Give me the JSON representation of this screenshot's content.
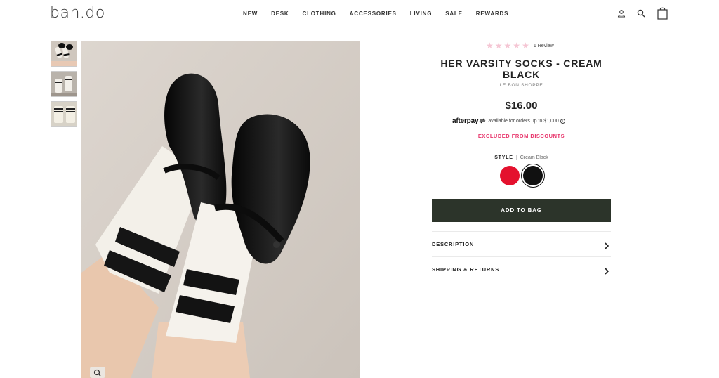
{
  "header": {
    "logo": "ban.dō",
    "nav": [
      "NEW",
      "DESK",
      "CLOTHING",
      "ACCESSORIES",
      "LIVING",
      "SALE",
      "REWARDS"
    ],
    "icons": [
      "account-icon",
      "search-icon",
      "cart-icon"
    ]
  },
  "gallery": {
    "thumbnails": [
      "thumbnail-1",
      "thumbnail-2",
      "thumbnail-3"
    ],
    "zoom_icon": "zoom-icon"
  },
  "product": {
    "rating_stars": 0,
    "rating_max": 5,
    "review_count": "1 Review",
    "title": "HER VARSITY SOCKS - CREAM BLACK",
    "brand": "LE BON SHOPPE",
    "price": "$16.00",
    "afterpay_logo": "afterpay",
    "afterpay_text": "available for orders up to $1,000",
    "excluded_text": "EXCLUDED FROM DISCOUNTS",
    "style_label": "STYLE",
    "style_value": "Cream Black",
    "swatches": [
      {
        "name": "red",
        "color": "#e4112e",
        "selected": false
      },
      {
        "name": "cream-black",
        "color": "#111111",
        "selected": true
      }
    ],
    "add_to_bag": "ADD TO BAG",
    "accordions": [
      "DESCRIPTION",
      "SHIPPING & RETURNS"
    ]
  },
  "colors": {
    "button": "#2c342a",
    "excluded": "#e8366c",
    "stars": "#f5c6d4"
  }
}
